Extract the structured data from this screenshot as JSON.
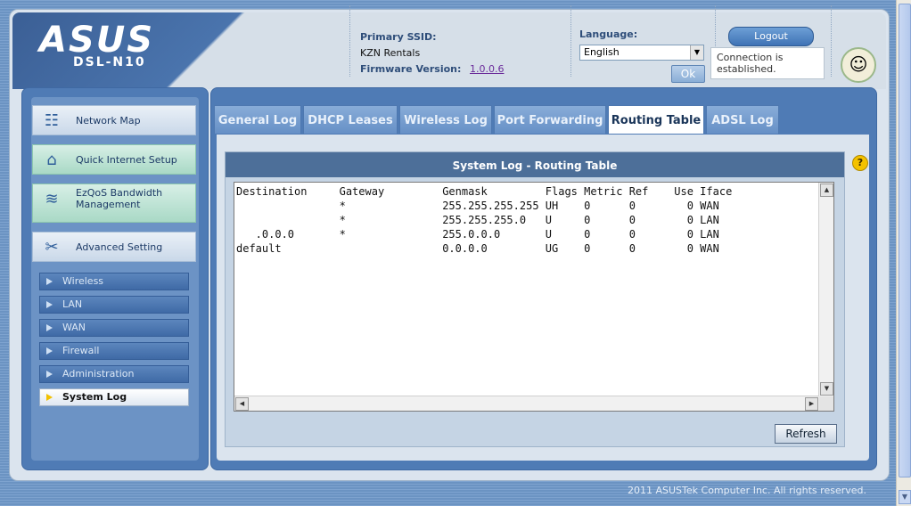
{
  "brand": {
    "logo": "ASUS",
    "model": "DSL-N10"
  },
  "header": {
    "ssid_label": "Primary SSID:",
    "ssid_value": "KZN Rentals",
    "firmware_label": "Firmware Version:",
    "firmware_value": "1.0.0.6",
    "language_label": "Language:",
    "language_value": "English",
    "ok_label": "Ok",
    "logout_label": "Logout",
    "connection_status": "Connection is established."
  },
  "sidebar": {
    "items": [
      {
        "label": "Network Map",
        "icon": "network-map-icon"
      },
      {
        "label": "Quick Internet Setup",
        "icon": "router-icon"
      },
      {
        "label": "EzQoS Bandwidth Management",
        "icon": "qos-icon"
      },
      {
        "label": "Advanced Setting",
        "icon": "tools-icon"
      }
    ],
    "sub_items": [
      {
        "label": "Wireless"
      },
      {
        "label": "LAN"
      },
      {
        "label": "WAN"
      },
      {
        "label": "Firewall"
      },
      {
        "label": "Administration"
      },
      {
        "label": "System Log",
        "active": true
      }
    ]
  },
  "tabs": [
    {
      "label": "General Log"
    },
    {
      "label": "DHCP Leases"
    },
    {
      "label": "Wireless Log"
    },
    {
      "label": "Port Forwarding"
    },
    {
      "label": "Routing Table",
      "active": true
    },
    {
      "label": "ADSL Log"
    }
  ],
  "panel": {
    "title": "System Log - Routing Table",
    "refresh_label": "Refresh",
    "log_text": "Destination     Gateway         Genmask         Flags Metric Ref    Use Iface\n                *               255.255.255.255 UH    0      0        0 WAN\n                *               255.255.255.0   U     0      0        0 LAN\n   .0.0.0       *               255.0.0.0       U     0      0        0 LAN\ndefault                         0.0.0.0         UG    0      0        0 WAN"
  },
  "footer": {
    "copyright": "2011 ASUSTek Computer Inc. All rights reserved."
  },
  "colors": {
    "accent": "#4f7bb5",
    "panel_title": "#4d6f99",
    "help": "#f4c200"
  }
}
